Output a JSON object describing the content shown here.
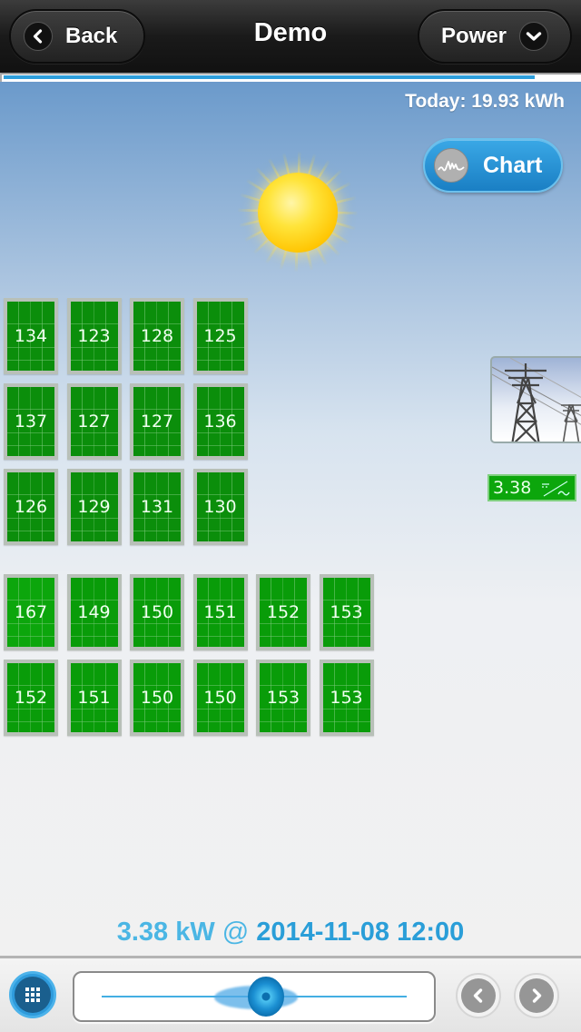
{
  "header": {
    "title": "Demo",
    "back_label": "Back",
    "power_label": "Power",
    "back_icon": "chevron-left-icon",
    "power_icon": "chevron-down-icon"
  },
  "loading_progress": 0.92,
  "today": {
    "text": "Today: 19.93 kWh"
  },
  "chart_button": {
    "label": "Chart",
    "icon": "waveform-icon"
  },
  "weather": {
    "icon": "sun-icon"
  },
  "panel_groups": [
    {
      "rows": [
        [
          "134",
          "123",
          "128",
          "125"
        ],
        [
          "137",
          "127",
          "127",
          "136"
        ],
        [
          "126",
          "129",
          "131",
          "130"
        ]
      ]
    },
    {
      "rows": [
        [
          "167",
          "149",
          "150",
          "151",
          "152",
          "153"
        ],
        [
          "152",
          "151",
          "150",
          "150",
          "153",
          "153"
        ]
      ]
    }
  ],
  "grid": {
    "icon": "power-line-tower-icon"
  },
  "inverter": {
    "value": "3.38",
    "icon": "ac-dc-icon"
  },
  "status": {
    "power": "3.38 kW",
    "separator": "@",
    "timestamp": "2014-11-08 12:00"
  },
  "footer": {
    "menu_icon": "grid-menu-icon",
    "slider_value": 0.54,
    "prev_icon": "chevron-left-icon",
    "next_icon": "chevron-right-icon"
  },
  "colors": {
    "accent": "#2e9fdc",
    "panel_green": "#0b8e0b",
    "header_bg": "#1a1a1a"
  }
}
